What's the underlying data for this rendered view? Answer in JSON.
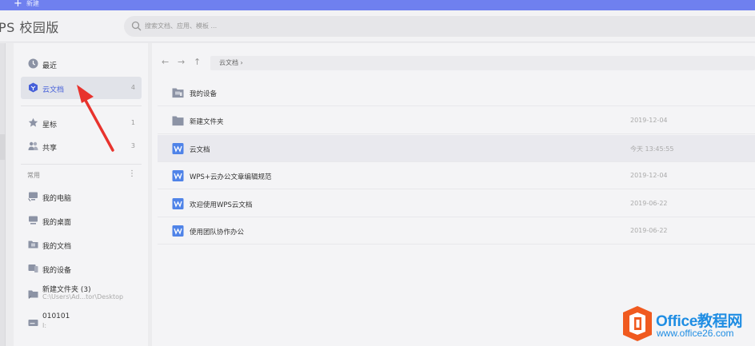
{
  "topbar": {
    "new_label": "新建"
  },
  "header": {
    "brand": "PS 校园版",
    "search_placeholder": "搜索文档、应用、模板 ..."
  },
  "sidebar": {
    "nav": [
      {
        "label": "最近",
        "count": ""
      },
      {
        "label": "云文档",
        "count": "4"
      },
      {
        "label": "星标",
        "count": "1"
      },
      {
        "label": "共享",
        "count": "3"
      }
    ],
    "section_title": "常用",
    "section_more": "⋮",
    "locations": [
      {
        "label": "我的电脑",
        "sub": ""
      },
      {
        "label": "我的桌面",
        "sub": ""
      },
      {
        "label": "我的文档",
        "sub": ""
      },
      {
        "label": "我的设备",
        "sub": ""
      },
      {
        "label": "新建文件夹 (3)",
        "sub": "C:\\Users\\Ad...tor\\Desktop"
      },
      {
        "label": "010101",
        "sub": "I:"
      }
    ]
  },
  "main": {
    "breadcrumb": "云文档  ›",
    "files": [
      {
        "name": "我的设备",
        "date": "",
        "type": "device"
      },
      {
        "name": "新建文件夹",
        "date": "2019-12-04",
        "type": "folder"
      },
      {
        "name": "云文档",
        "date": "今天 13:45:55",
        "type": "doc"
      },
      {
        "name": "WPS+云办公文章编辑规范",
        "date": "2019-12-04",
        "type": "doc"
      },
      {
        "name": "欢迎使用WPS云文档",
        "date": "2019-06-22",
        "type": "doc"
      },
      {
        "name": "使用团队协作办公",
        "date": "2019-06-22",
        "type": "doc"
      }
    ]
  },
  "watermark": {
    "title": "Office教程网",
    "url": "www.office26.com"
  },
  "colors": {
    "accent": "#4660d9",
    "topbar": "#6f80ef",
    "arrow": "#e8332d",
    "watermark_blue": "#1f8de3",
    "watermark_orange": "#f05a1f"
  }
}
